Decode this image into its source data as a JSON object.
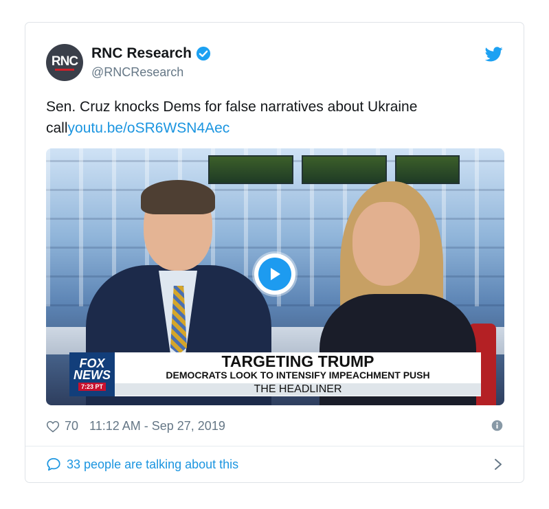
{
  "tweet": {
    "author": {
      "avatar_text": "RNC",
      "name": "RNC Research",
      "handle": "@RNCResearch",
      "verified": true
    },
    "text_prefix": "Sen. Cruz knocks Dems for false narratives about Ukraine call",
    "link": "youtu.be/oSR6WSN4Aec",
    "video": {
      "channel_logo_line1": "FOX",
      "channel_logo_line2": "NEWS",
      "timestamp": "7:23 PT",
      "headline": "TARGETING TRUMP",
      "subheadline": "DEMOCRATS LOOK TO INTENSIFY IMPEACHMENT PUSH",
      "show_name": "THE HEADLINER"
    },
    "likes": "70",
    "posted_at": "11:12 AM - Sep 27, 2019",
    "talking": "33 people are talking about this"
  },
  "colors": {
    "accent": "#1b95e0",
    "text": "#14171a",
    "muted": "#657786",
    "border": "#dfe3e8"
  },
  "icons": [
    "verified-badge-icon",
    "twitter-bird-icon",
    "play-icon",
    "heart-icon",
    "info-icon",
    "speech-bubble-icon",
    "chevron-right-icon"
  ]
}
